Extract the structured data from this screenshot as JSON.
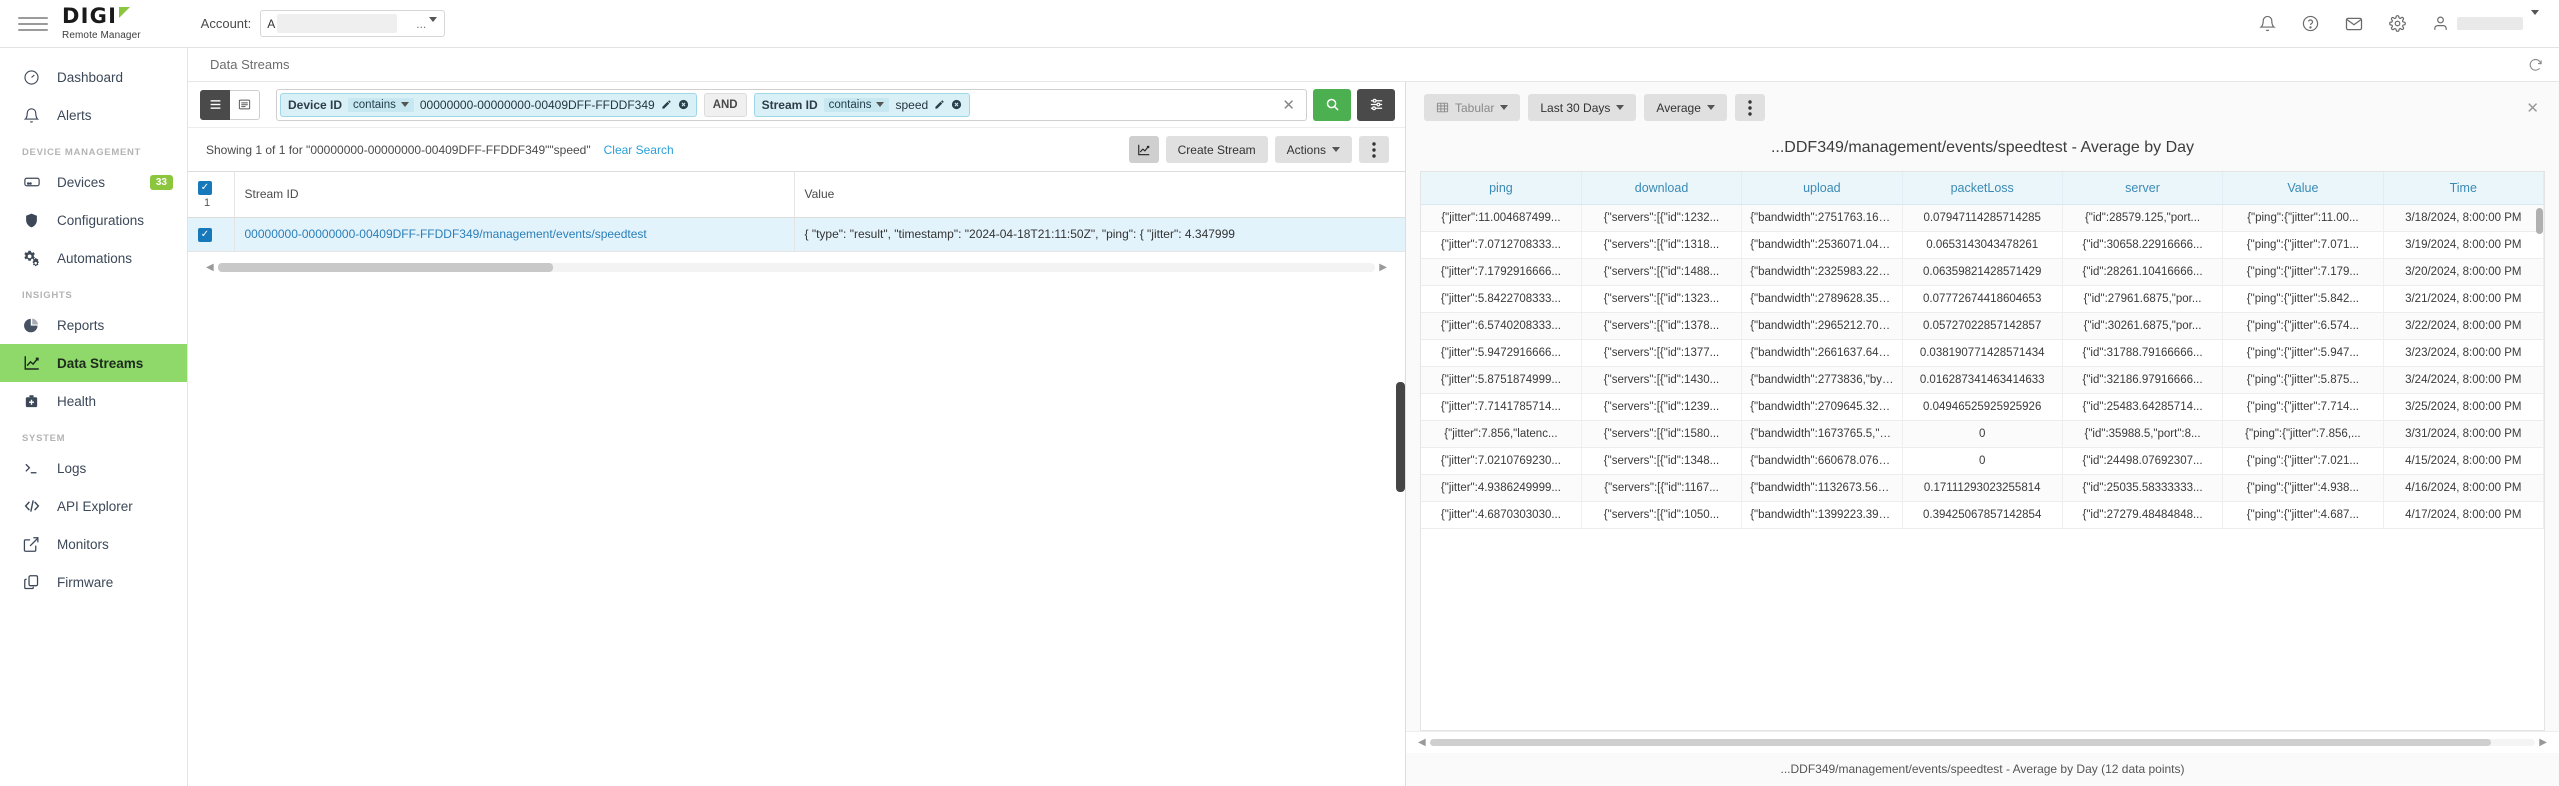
{
  "topbar": {
    "brand_name": "DIGI",
    "brand_sub": "Remote Manager",
    "account_label": "Account:",
    "account_value": "A",
    "account_dots": "...",
    "icons": [
      "notification-bell-icon",
      "help-icon",
      "mail-icon",
      "gear-icon",
      "user-icon"
    ]
  },
  "sidebar": {
    "items": [
      {
        "label": "Dashboard",
        "icon": "gauge-icon",
        "type": "item",
        "active": false
      },
      {
        "label": "Alerts",
        "icon": "bell-icon",
        "type": "item",
        "active": false
      },
      {
        "label": "DEVICE MANAGEMENT",
        "type": "section"
      },
      {
        "label": "Devices",
        "icon": "device-icon",
        "type": "item",
        "active": false,
        "badge": "33"
      },
      {
        "label": "Configurations",
        "icon": "shield-icon",
        "type": "item",
        "active": false
      },
      {
        "label": "Automations",
        "icon": "gears-icon",
        "type": "item",
        "active": false
      },
      {
        "label": "INSIGHTS",
        "type": "section"
      },
      {
        "label": "Reports",
        "icon": "pie-chart-icon",
        "type": "item",
        "active": false
      },
      {
        "label": "Data Streams",
        "icon": "line-chart-icon",
        "type": "item",
        "active": true
      },
      {
        "label": "Health",
        "icon": "health-kit-icon",
        "type": "item",
        "active": false
      },
      {
        "label": "SYSTEM",
        "type": "section"
      },
      {
        "label": "Logs",
        "icon": "terminal-icon",
        "type": "item",
        "active": false
      },
      {
        "label": "API Explorer",
        "icon": "code-icon",
        "type": "item",
        "active": false
      },
      {
        "label": "Monitors",
        "icon": "external-link-icon",
        "type": "item",
        "active": false
      },
      {
        "label": "Firmware",
        "icon": "copy-icon",
        "type": "item",
        "active": false
      }
    ]
  },
  "page": {
    "title": "Data Streams",
    "refresh_icon": "refresh-icon"
  },
  "filters": {
    "view_list_icon": "list-view-icon",
    "view_detail_icon": "detail-view-icon",
    "chips": [
      {
        "label": "Device ID",
        "operator": "contains",
        "value": "00000000-00000000-00409DFF-FFDDF349"
      },
      {
        "label": "Stream ID",
        "operator": "contains",
        "value": "speed"
      }
    ],
    "conjunction": "AND",
    "clear_icon": "close-icon",
    "search_icon": "search-icon",
    "settings_icon": "filter-settings-icon"
  },
  "results": {
    "showing_text": "Showing 1 of 1 for \"00000000-00000000-00409DFF-FFDDF349\"\"speed\"",
    "clear_search": "Clear Search",
    "chart_toggle_icon": "chart-icon",
    "create_stream": "Create Stream",
    "actions": "Actions",
    "more_icon": "vertical-dots-icon"
  },
  "streams_table": {
    "selected_count": "1",
    "columns": [
      "Stream ID",
      "Value"
    ],
    "rows": [
      {
        "selected": true,
        "stream_id": "00000000-00000000-00409DFF-FFDDF349/management/events/speedtest",
        "value": "{ \"type\": \"result\", \"timestamp\": \"2024-04-18T21:11:50Z\", \"ping\": { \"jitter\": 4.347999"
      }
    ]
  },
  "chart_panel": {
    "view_mode": "Tabular",
    "view_mode_icon": "table-icon",
    "time_range": "Last 30 Days",
    "aggregate": "Average",
    "more_icon": "vertical-dots-icon",
    "close_icon": "close-icon",
    "title": "...DDF349/management/events/speedtest - Average by Day",
    "caption": "...DDF349/management/events/speedtest - Average by Day (12 data points)"
  },
  "chart_data": {
    "type": "table",
    "title": "...DDF349/management/events/speedtest - Average by Day",
    "caption": "...DDF349/management/events/speedtest - Average by Day (12 data points)",
    "columns": [
      "ping",
      "download",
      "upload",
      "packetLoss",
      "server",
      "Value",
      "Time"
    ],
    "point_count": 12,
    "rows": [
      {
        "ping": "{\"jitter\":11.004687499...",
        "download": "{\"servers\":[{\"id\":1232...",
        "upload": "{\"bandwidth\":2751763.1666...",
        "packetLoss": "0.07947114285714285",
        "server": "{\"id\":28579.125,\"port...",
        "Value": "{\"ping\":{\"jitter\":11.00...",
        "Time": "3/18/2024, 8:00:00 PM"
      },
      {
        "ping": "{\"jitter\":7.0712708333...",
        "download": "{\"servers\":[{\"id\":1318...",
        "upload": "{\"bandwidth\":2536071.0416...",
        "packetLoss": "0.0653143043478261",
        "server": "{\"id\":30658.22916666...",
        "Value": "{\"ping\":{\"jitter\":7.071...",
        "Time": "3/19/2024, 8:00:00 PM"
      },
      {
        "ping": "{\"jitter\":7.1792916666...",
        "download": "{\"servers\":[{\"id\":1488...",
        "upload": "{\"bandwidth\":2325983.2291...",
        "packetLoss": "0.06359821428571429",
        "server": "{\"id\":28261.10416666...",
        "Value": "{\"ping\":{\"jitter\":7.179...",
        "Time": "3/20/2024, 8:00:00 PM"
      },
      {
        "ping": "{\"jitter\":5.8422708333...",
        "download": "{\"servers\":[{\"id\":1323...",
        "upload": "{\"bandwidth\":2789628.3541...",
        "packetLoss": "0.07772674418604653",
        "server": "{\"id\":27961.6875,\"por...",
        "Value": "{\"ping\":{\"jitter\":5.842...",
        "Time": "3/21/2024, 8:00:00 PM"
      },
      {
        "ping": "{\"jitter\":6.5740208333...",
        "download": "{\"servers\":[{\"id\":1378...",
        "upload": "{\"bandwidth\":2965212.7083...",
        "packetLoss": "0.05727022857142857",
        "server": "{\"id\":30261.6875,\"por...",
        "Value": "{\"ping\":{\"jitter\":6.574...",
        "Time": "3/22/2024, 8:00:00 PM"
      },
      {
        "ping": "{\"jitter\":5.9472916666...",
        "download": "{\"servers\":[{\"id\":1377...",
        "upload": "{\"bandwidth\":2661637.6458...",
        "packetLoss": "0.038190771428571434",
        "server": "{\"id\":31788.79166666...",
        "Value": "{\"ping\":{\"jitter\":5.947...",
        "Time": "3/23/2024, 8:00:00 PM"
      },
      {
        "ping": "{\"jitter\":5.8751874999...",
        "download": "{\"servers\":[{\"id\":1430...",
        "upload": "{\"bandwidth\":2773836,\"byt...",
        "packetLoss": "0.016287341463414633",
        "server": "{\"id\":32186.97916666...",
        "Value": "{\"ping\":{\"jitter\":5.875...",
        "Time": "3/24/2024, 8:00:00 PM"
      },
      {
        "ping": "{\"jitter\":7.7141785714...",
        "download": "{\"servers\":[{\"id\":1239...",
        "upload": "{\"bandwidth\":2709645.3214...",
        "packetLoss": "0.04946525925925926",
        "server": "{\"id\":25483.64285714...",
        "Value": "{\"ping\":{\"jitter\":7.714...",
        "Time": "3/25/2024, 8:00:00 PM"
      },
      {
        "ping": "{\"jitter\":7.856,\"latenc...",
        "download": "{\"servers\":[{\"id\":1580...",
        "upload": "{\"bandwidth\":1673765.5,\"b...",
        "packetLoss": "0",
        "server": "{\"id\":35988.5,\"port\":8...",
        "Value": "{\"ping\":{\"jitter\":7.856,...",
        "Time": "3/31/2024, 8:00:00 PM"
      },
      {
        "ping": "{\"jitter\":7.0210769230...",
        "download": "{\"servers\":[{\"id\":1348...",
        "upload": "{\"bandwidth\":660678.07692...",
        "packetLoss": "0",
        "server": "{\"id\":24498.07692307...",
        "Value": "{\"ping\":{\"jitter\":7.021...",
        "Time": "4/15/2024, 8:00:00 PM"
      },
      {
        "ping": "{\"jitter\":4.9386249999...",
        "download": "{\"servers\":[{\"id\":1167...",
        "upload": "{\"bandwidth\":1132673.5625...",
        "packetLoss": "0.17111293023255814",
        "server": "{\"id\":25035.58333333...",
        "Value": "{\"ping\":{\"jitter\":4.938...",
        "Time": "4/16/2024, 8:00:00 PM"
      },
      {
        "ping": "{\"jitter\":4.6870303030...",
        "download": "{\"servers\":[{\"id\":1050...",
        "upload": "{\"bandwidth\":1399223.3939...",
        "packetLoss": "0.39425067857142854",
        "server": "{\"id\":27279.48484848...",
        "Value": "{\"ping\":{\"jitter\":4.687...",
        "Time": "4/17/2024, 8:00:00 PM"
      }
    ]
  },
  "colors": {
    "accent_green": "#8ed96a",
    "brand_green": "#8cc63f",
    "search_green": "#4caf50",
    "chip_blue": "#d9f0f7",
    "link_blue": "#2a7fb8",
    "header_blue": "#3b8ab5"
  }
}
